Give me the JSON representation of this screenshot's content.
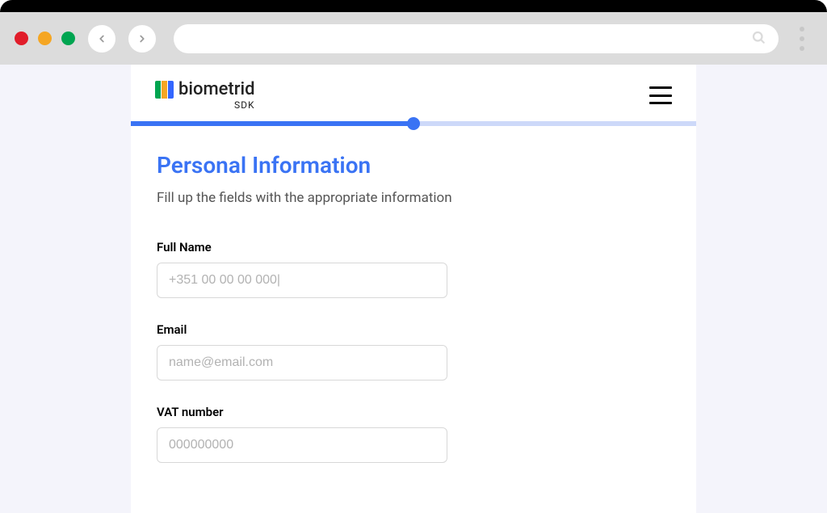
{
  "app": {
    "logo_name": "biometrid",
    "logo_sub": "SDK"
  },
  "progress": {
    "percent": 50
  },
  "section": {
    "title": "Personal Information",
    "subtitle": "Fill up the fields with the appropriate information"
  },
  "fields": {
    "full_name": {
      "label": "Full Name",
      "placeholder": "+351 00 00 00 000|",
      "value": ""
    },
    "email": {
      "label": "Email",
      "placeholder": "name@email.com",
      "value": ""
    },
    "vat": {
      "label": "VAT number",
      "placeholder": "000000000",
      "value": ""
    }
  }
}
